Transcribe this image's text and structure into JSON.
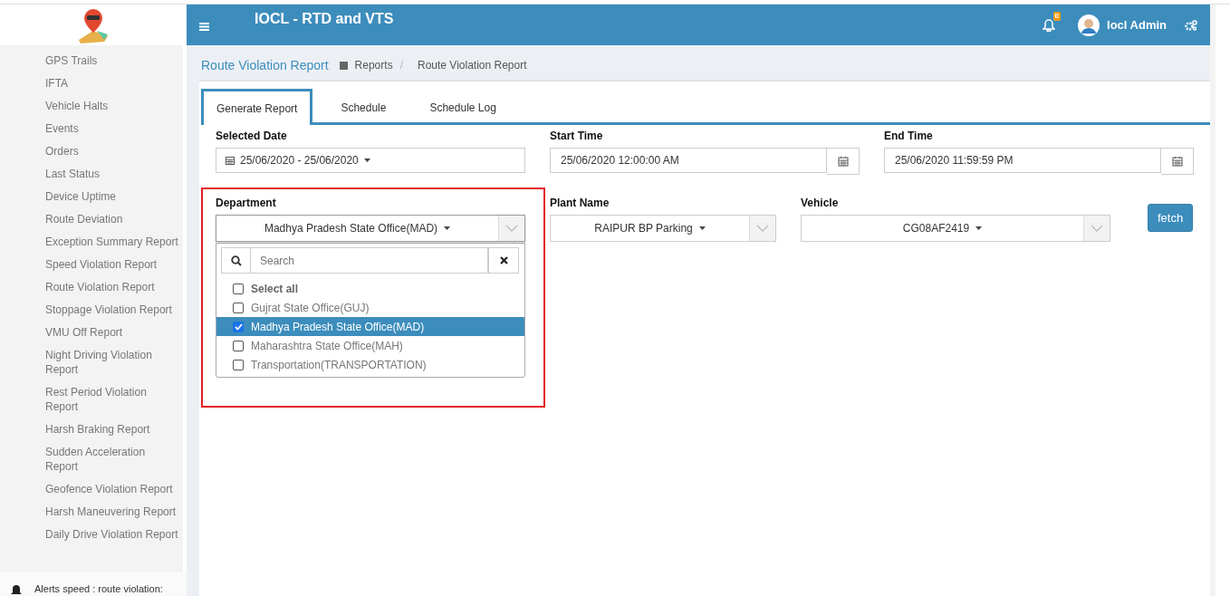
{
  "header": {
    "title": "IOCL - RTD and VTS",
    "notification_count": "0",
    "user_name": "Iocl Admin"
  },
  "sidebar": {
    "items": [
      {
        "label": "GPS Trails"
      },
      {
        "label": "IFTA"
      },
      {
        "label": "Vehicle Halts"
      },
      {
        "label": "Events"
      },
      {
        "label": "Orders"
      },
      {
        "label": "Last Status"
      },
      {
        "label": "Device Uptime"
      },
      {
        "label": "Route Deviation"
      },
      {
        "label": "Exception Summary Report"
      },
      {
        "label": "Speed Violation Report"
      },
      {
        "label": "Route Violation Report"
      },
      {
        "label": "Stoppage Violation Report"
      },
      {
        "label": "VMU Off Report"
      },
      {
        "label": "Night Driving Violation Report"
      },
      {
        "label": "Rest Period Violation Report"
      },
      {
        "label": "Harsh Braking Report"
      },
      {
        "label": "Sudden Acceleration Report"
      },
      {
        "label": "Geofence Violation Report"
      },
      {
        "label": "Harsh Maneuvering Report"
      },
      {
        "label": "Daily Drive Violation Report"
      }
    ],
    "alert": "Alerts speed : route violation:"
  },
  "page": {
    "title": "Route Violation Report",
    "breadcrumb": [
      "Reports",
      "Route Violation Report"
    ],
    "breadcrumb_separator": "/"
  },
  "tabs": [
    {
      "label": "Generate Report",
      "selected": true
    },
    {
      "label": "Schedule",
      "selected": false
    },
    {
      "label": "Schedule Log",
      "selected": false
    }
  ],
  "date_fields": [
    {
      "kind": "range",
      "label": "Selected Date",
      "value": "25/06/2020 - 25/06/2020"
    },
    {
      "kind": "time",
      "label": "Start Time",
      "value": "25/06/2020 12:00:00 AM"
    },
    {
      "kind": "time",
      "label": "End Time",
      "value": "25/06/2020 11:59:59 PM"
    }
  ],
  "selectors": [
    {
      "label": "Department",
      "value": "Madhya Pradesh State Office(MAD)",
      "expanded": true
    },
    {
      "label": "Plant Name",
      "value": "RAIPUR BP Parking",
      "expanded": false
    },
    {
      "label": "Vehicle",
      "value": "CG08AF2419",
      "expanded": false
    }
  ],
  "dropdown": {
    "search_placeholder": "Search",
    "options": [
      {
        "kind": "select-all",
        "label": "Select all",
        "checked": false,
        "selected": false
      },
      {
        "kind": "option",
        "label": "Gujrat State Office(GUJ)",
        "checked": false,
        "selected": false
      },
      {
        "kind": "option",
        "label": "Madhya Pradesh State Office(MAD)",
        "checked": true,
        "selected": true
      },
      {
        "kind": "option",
        "label": "Maharashtra State Office(MAH)",
        "checked": false,
        "selected": false
      },
      {
        "kind": "option",
        "label": "Transportation(TRANSPORTATION)",
        "checked": false,
        "selected": false
      }
    ]
  },
  "fetch_button": "fetch"
}
